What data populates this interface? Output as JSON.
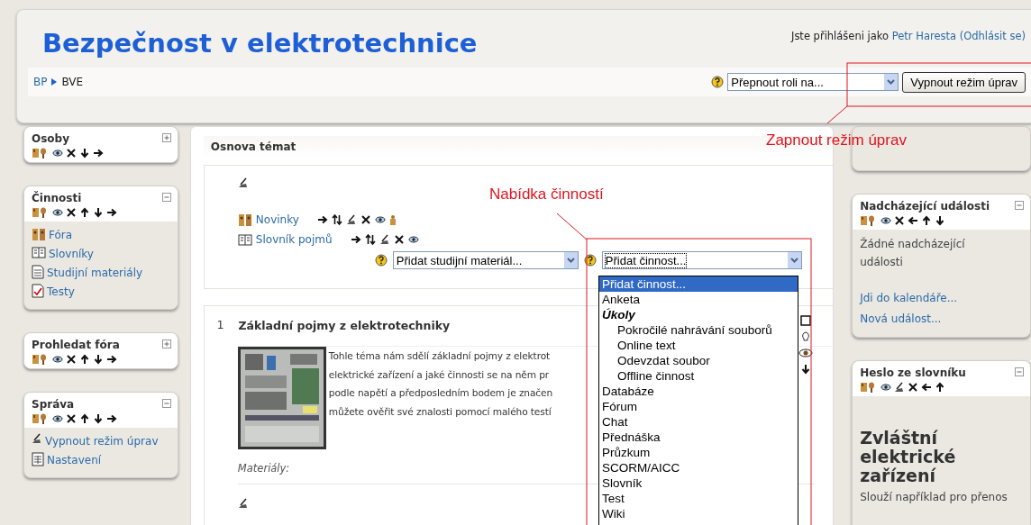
{
  "header": {
    "title": "Bezpečnost v elektrotechnice",
    "login_prefix": "Jste přihlášeni jako",
    "user": "Petr Haresta",
    "logout": "(Odhlásit se)"
  },
  "breadcrumb": [
    "BP",
    "BVE"
  ],
  "role_select": {
    "value": "Přepnout roli na..."
  },
  "edit_button": {
    "label": "Vypnout režim úprav"
  },
  "left_blocks": [
    {
      "title": "Osoby",
      "collapsed": true,
      "tools": [
        {
          "kind": "roles"
        },
        {
          "kind": "eye"
        },
        {
          "kind": "delete"
        },
        {
          "kind": "down"
        },
        {
          "kind": "right"
        }
      ]
    },
    {
      "title": "Činnosti",
      "collapsed": false,
      "tools": [
        {
          "kind": "roles"
        },
        {
          "kind": "eye"
        },
        {
          "kind": "delete"
        },
        {
          "kind": "up"
        },
        {
          "kind": "down"
        },
        {
          "kind": "right"
        }
      ],
      "items": [
        {
          "label": "Fóra",
          "kind": "forum"
        },
        {
          "label": "Slovníky",
          "kind": "glossary"
        },
        {
          "label": "Studijní materiály",
          "kind": "resource"
        },
        {
          "label": "Testy",
          "kind": "quiz"
        }
      ]
    },
    {
      "title": "Prohledat fóra",
      "collapsed": true,
      "tools": [
        {
          "kind": "roles"
        },
        {
          "kind": "eye"
        },
        {
          "kind": "delete"
        },
        {
          "kind": "up"
        },
        {
          "kind": "down"
        },
        {
          "kind": "right"
        }
      ]
    },
    {
      "title": "Správa",
      "collapsed": false,
      "tools": [
        {
          "kind": "roles"
        },
        {
          "kind": "eye"
        },
        {
          "kind": "delete"
        },
        {
          "kind": "up"
        },
        {
          "kind": "down"
        },
        {
          "kind": "right"
        }
      ],
      "items": [
        {
          "label": "Vypnout režim úprav",
          "kind": "edit"
        },
        {
          "label": "Nastavení",
          "kind": "settings"
        }
      ]
    }
  ],
  "course": {
    "heading": "Osnova témat",
    "section_0": {
      "activities": [
        {
          "label": "Novinky",
          "kind": "forum",
          "tools": [
            {
              "kind": "right"
            },
            {
              "kind": "move"
            },
            {
              "kind": "edit"
            },
            {
              "kind": "delete"
            },
            {
              "kind": "eye"
            },
            {
              "kind": "group"
            }
          ]
        },
        {
          "label": "Slovník pojmů",
          "kind": "glossary",
          "tools": [
            {
              "kind": "right"
            },
            {
              "kind": "move"
            },
            {
              "kind": "edit"
            },
            {
              "kind": "delete"
            },
            {
              "kind": "eye"
            }
          ]
        }
      ],
      "add_resource": "Přidat studijní materiál...",
      "add_activity": "Přidat činnost..."
    },
    "section_1": {
      "number": "1",
      "title": "Základní pojmy z elektrotechniky",
      "summary_lines": [
        "Tohle téma nám sdělí základní pojmy z elektrot",
        "elektrické zařízení a jaké činnosti se na něm pr",
        "podle napětí a předposledním bodem je značen",
        "můžete ověřit své znalosti pomocí malého testí"
      ],
      "materials_label": "Materiály:",
      "tools": [
        {
          "kind": "square"
        },
        {
          "kind": "bulb"
        },
        {
          "kind": "eye-large"
        },
        {
          "kind": "down"
        }
      ]
    }
  },
  "activity_menu": [
    {
      "label": "Přidat činnost...",
      "kind": "option",
      "selected": true
    },
    {
      "label": "Anketa",
      "kind": "option",
      "selected": false
    },
    {
      "label": "Úkoly",
      "kind": "group",
      "children": [
        {
          "label": "Pokročilé nahrávání souborů",
          "selected": false
        },
        {
          "label": "Online text",
          "selected": false
        },
        {
          "label": "Odevzdat soubor",
          "selected": false
        },
        {
          "label": "Offline činnost",
          "selected": false
        }
      ]
    },
    {
      "label": "Databáze",
      "kind": "option",
      "selected": false
    },
    {
      "label": "Fórum",
      "kind": "option",
      "selected": false
    },
    {
      "label": "Chat",
      "kind": "option",
      "selected": false
    },
    {
      "label": "Přednáška",
      "kind": "option",
      "selected": false
    },
    {
      "label": "Průzkum",
      "kind": "option",
      "selected": false
    },
    {
      "label": "SCORM/AICC",
      "kind": "option",
      "selected": false
    },
    {
      "label": "Slovník",
      "kind": "option",
      "selected": false
    },
    {
      "label": "Test",
      "kind": "option",
      "selected": false
    },
    {
      "label": "Wiki",
      "kind": "option",
      "selected": false
    }
  ],
  "right_blocks": [
    {
      "kind": "empty"
    },
    {
      "kind": "events",
      "title": "Nadcházející události",
      "collapsed": false,
      "tools": [
        {
          "kind": "roles"
        },
        {
          "kind": "eye"
        },
        {
          "kind": "delete"
        },
        {
          "kind": "left"
        },
        {
          "kind": "up"
        },
        {
          "kind": "down"
        }
      ],
      "text": "Žádné nadcházející události",
      "links": [
        "Jdi do kalendáře...",
        "Nová událost..."
      ]
    },
    {
      "kind": "glossary",
      "title": "Heslo ze slovníku",
      "collapsed": false,
      "tools": [
        {
          "kind": "roles"
        },
        {
          "kind": "eye"
        },
        {
          "kind": "edit"
        },
        {
          "kind": "delete"
        },
        {
          "kind": "left"
        },
        {
          "kind": "up"
        }
      ],
      "term": "Zvláštní elektrické zařízení",
      "definition": "Slouží například pro přenos"
    }
  ],
  "annotations": [
    {
      "text": "Zapnout režim úprav"
    },
    {
      "text": "Nabídka činností"
    }
  ]
}
